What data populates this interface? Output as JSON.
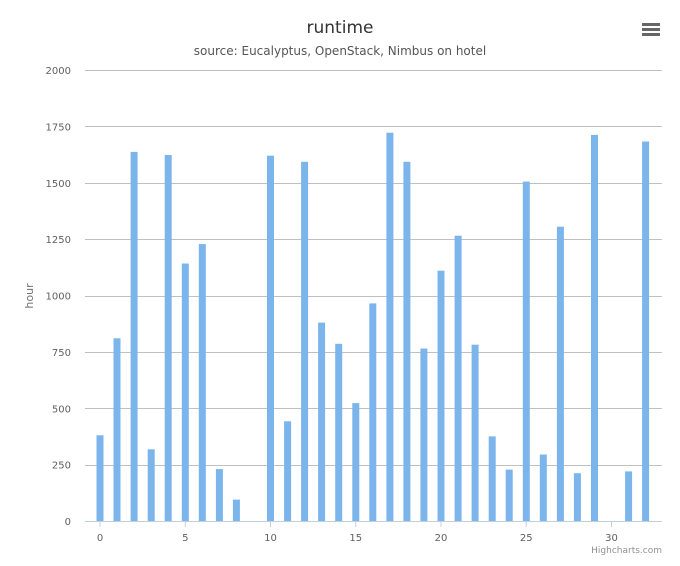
{
  "chart_data": {
    "type": "bar",
    "title": "runtime",
    "subtitle": "source: Eucalyptus, OpenStack, Nimbus on hotel",
    "xlabel": "",
    "ylabel": "hour",
    "xlim": [
      0,
      32
    ],
    "ylim": [
      0,
      2000
    ],
    "x_ticks": [
      0,
      5,
      10,
      15,
      20,
      25,
      30
    ],
    "y_ticks": [
      0,
      250,
      500,
      750,
      1000,
      1250,
      1500,
      1750,
      2000
    ],
    "grid": true,
    "legend": "none",
    "bar_color": "#7cb5ec",
    "grid_color": "#c0c0c0",
    "x": [
      0,
      1,
      2,
      3,
      4,
      5,
      6,
      7,
      8,
      9,
      10,
      11,
      12,
      13,
      14,
      15,
      16,
      17,
      18,
      19,
      20,
      21,
      22,
      23,
      24,
      25,
      26,
      27,
      28,
      29,
      30,
      31,
      32
    ],
    "values": [
      380,
      810,
      1637,
      318,
      1623,
      1142,
      1228,
      230,
      95,
      0,
      1620,
      442,
      1593,
      880,
      786,
      523,
      965,
      1722,
      1593,
      765,
      1110,
      1265,
      782,
      375,
      228,
      1505,
      295,
      1305,
      212,
      1712,
      0,
      220,
      1683
    ]
  },
  "credits": "Highcharts.com",
  "menu_icon": "menu-icon"
}
